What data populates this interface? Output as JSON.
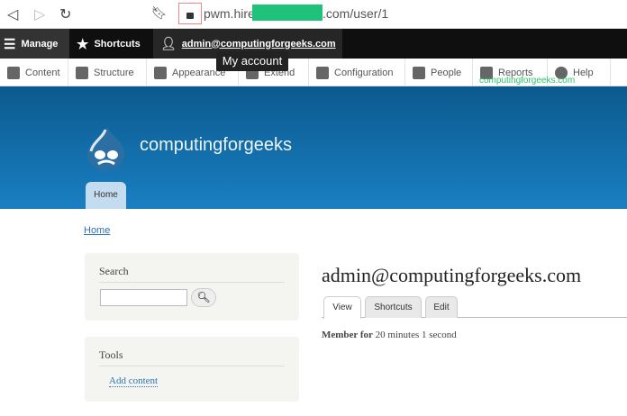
{
  "browser": {
    "url_prefix": "pwm.hire",
    "url_suffix": ".com/user/1"
  },
  "toolbar": {
    "manage": "Manage",
    "shortcuts": "Shortcuts",
    "user": "admin@computingforgeeks.com",
    "tooltip": "My account"
  },
  "tray": {
    "items": [
      {
        "label": "Content"
      },
      {
        "label": "Structure"
      },
      {
        "label": "Appearance"
      },
      {
        "label": "Extend"
      },
      {
        "label": "Configuration"
      },
      {
        "label": "People"
      },
      {
        "label": "Reports"
      },
      {
        "label": "Help"
      }
    ]
  },
  "watermark": "computingforgeeks.com",
  "header": {
    "site_name": "computingforgeeks",
    "home_tab": "Home"
  },
  "breadcrumb": "Home",
  "sidebar": {
    "search_title": "Search",
    "search_value": "",
    "tools_title": "Tools",
    "add_content": "Add content"
  },
  "main": {
    "title": "admin@computingforgeeks.com",
    "tabs": [
      {
        "label": "View"
      },
      {
        "label": "Shortcuts"
      },
      {
        "label": "Edit"
      }
    ],
    "member_label": "Member for",
    "member_value": "20 minutes 1 second"
  }
}
